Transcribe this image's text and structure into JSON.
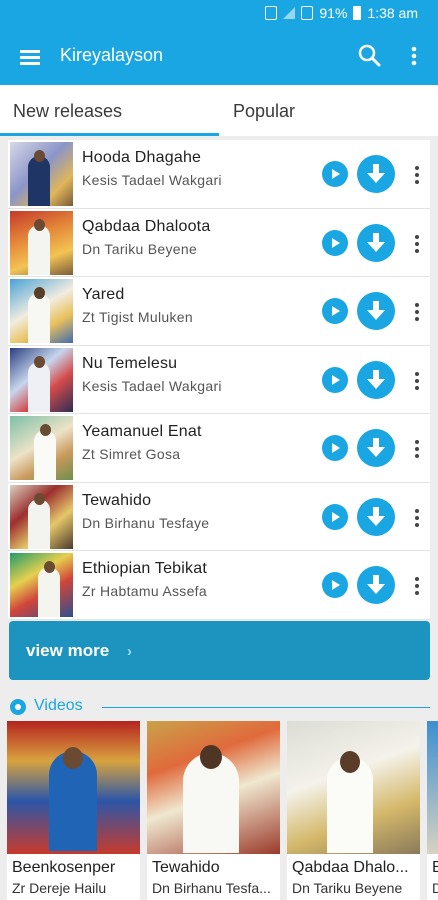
{
  "status": {
    "battery": "91%",
    "time": "1:38 am"
  },
  "app": {
    "title": "Kireyalayson"
  },
  "tabs": [
    {
      "label": "New releases"
    },
    {
      "label": "Popular"
    }
  ],
  "songs": [
    {
      "title": "Hooda Dhagahe",
      "artist": "Kesis Tadael Wakgari"
    },
    {
      "title": "Qabdaa Dhaloota",
      "artist": "Dn Tariku Beyene"
    },
    {
      "title": "Yared",
      "artist": "Zt Tigist Muluken"
    },
    {
      "title": "Nu Temelesu",
      "artist": "Kesis Tadael Wakgari"
    },
    {
      "title": "Yeamanuel Enat",
      "artist": "Zt Simret Gosa"
    },
    {
      "title": "Tewahido",
      "artist": "Dn Birhanu Tesfaye"
    },
    {
      "title": "Ethiopian Tebikat",
      "artist": "Zr Habtamu Assefa"
    }
  ],
  "view_more": {
    "label": "view more"
  },
  "videos": {
    "label": "Videos",
    "items": [
      {
        "title": "Beenkosenper",
        "artist": "Zr Dereje Hailu"
      },
      {
        "title": "Tewahido",
        "artist": "Dn Birhanu Tesfa..."
      },
      {
        "title": "Qabdaa Dhalo...",
        "artist": "Dn Tariku Beyene"
      },
      {
        "title": "B",
        "artist": "D"
      }
    ]
  },
  "colors": {
    "accent": "#1aa6e2",
    "button": "#1d93bf"
  },
  "icons": {
    "menu": "hamburger-icon",
    "search": "search-icon",
    "more": "more-vert-icon",
    "play": "play-icon",
    "download": "download-icon"
  }
}
